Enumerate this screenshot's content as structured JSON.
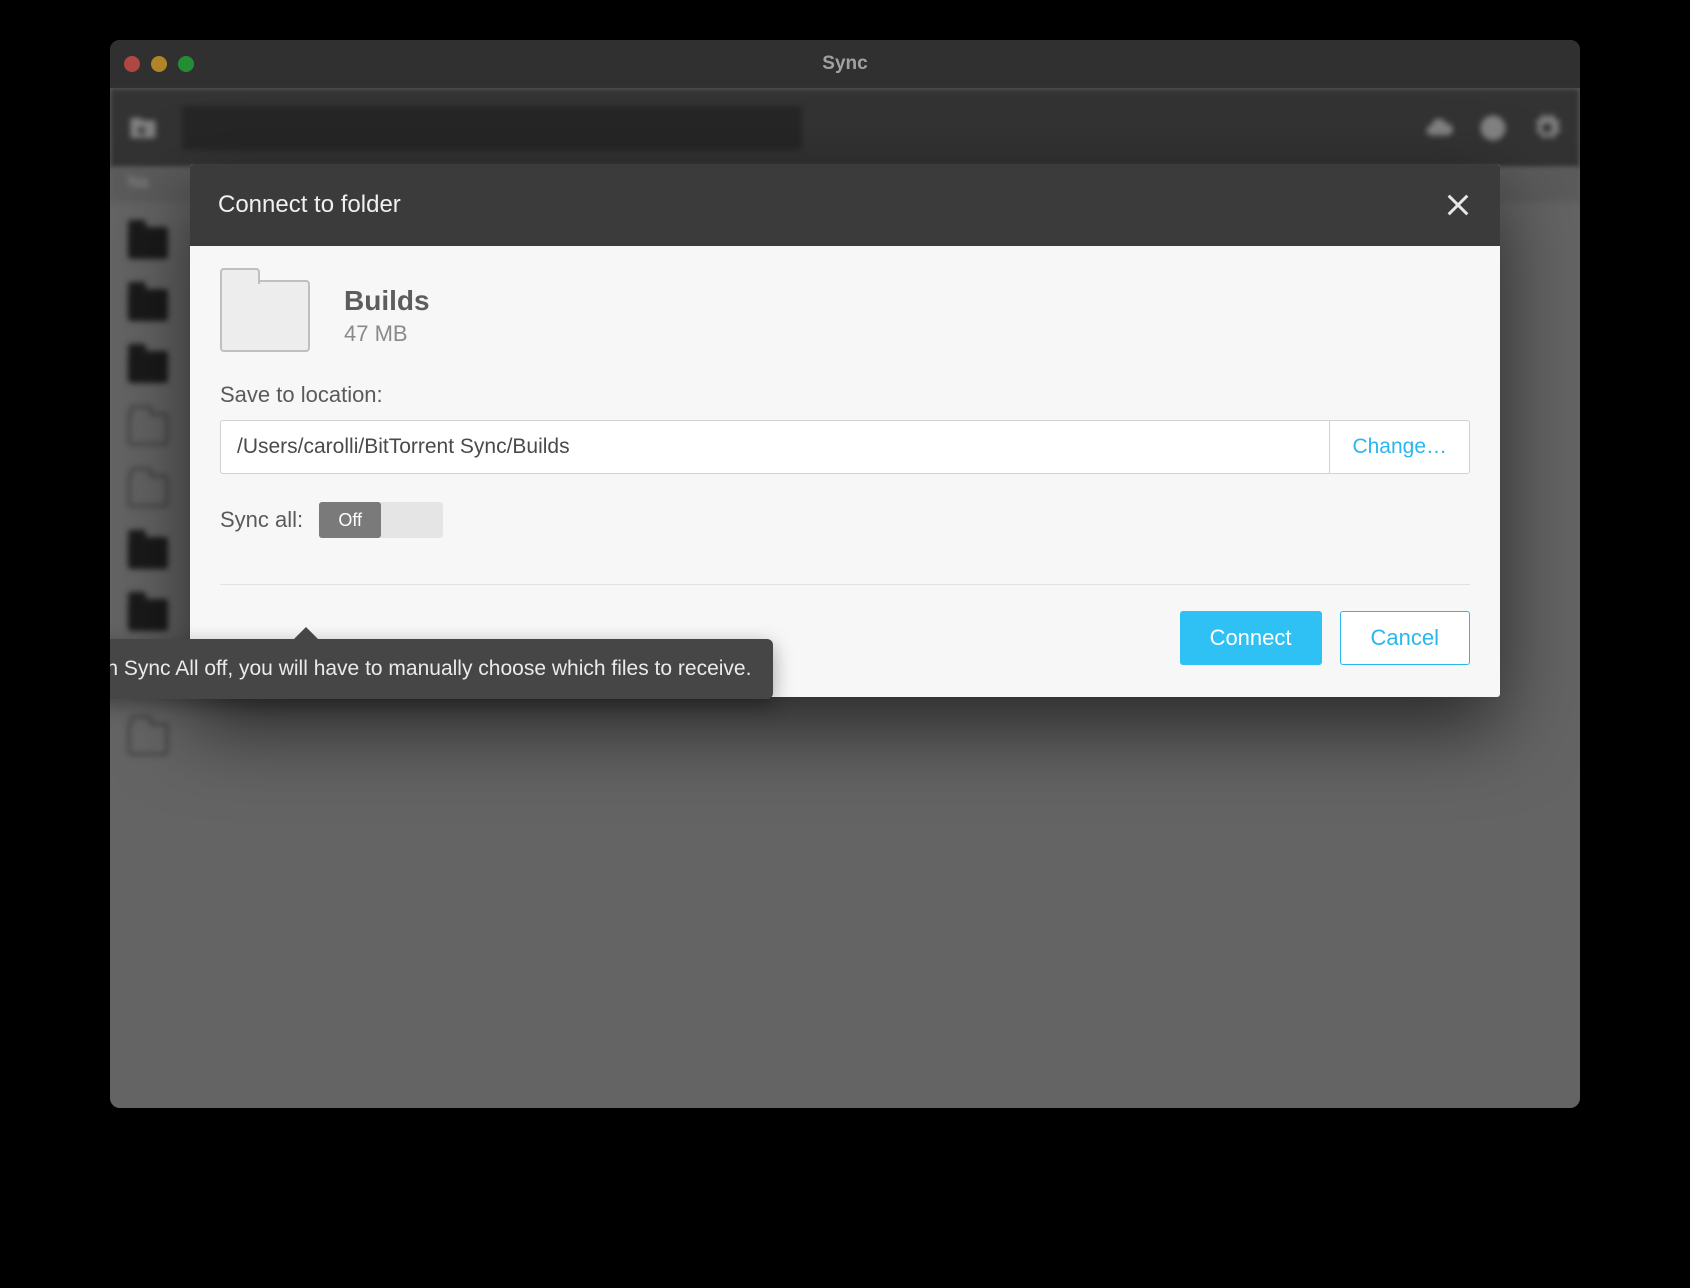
{
  "window": {
    "title": "Sync",
    "list_header": "Na"
  },
  "dialog": {
    "title": "Connect to folder",
    "folder_name": "Builds",
    "folder_size": "47 MB",
    "location_label": "Save to location:",
    "location_path": "/Users/carolli/BitTorrent Sync/Builds",
    "change_label": "Change…",
    "sync_all_label": "Sync all:",
    "toggle_state": "Off",
    "tooltip": "With Sync All off, you will have to manually choose which files to receive.",
    "connect_label": "Connect",
    "cancel_label": "Cancel"
  }
}
